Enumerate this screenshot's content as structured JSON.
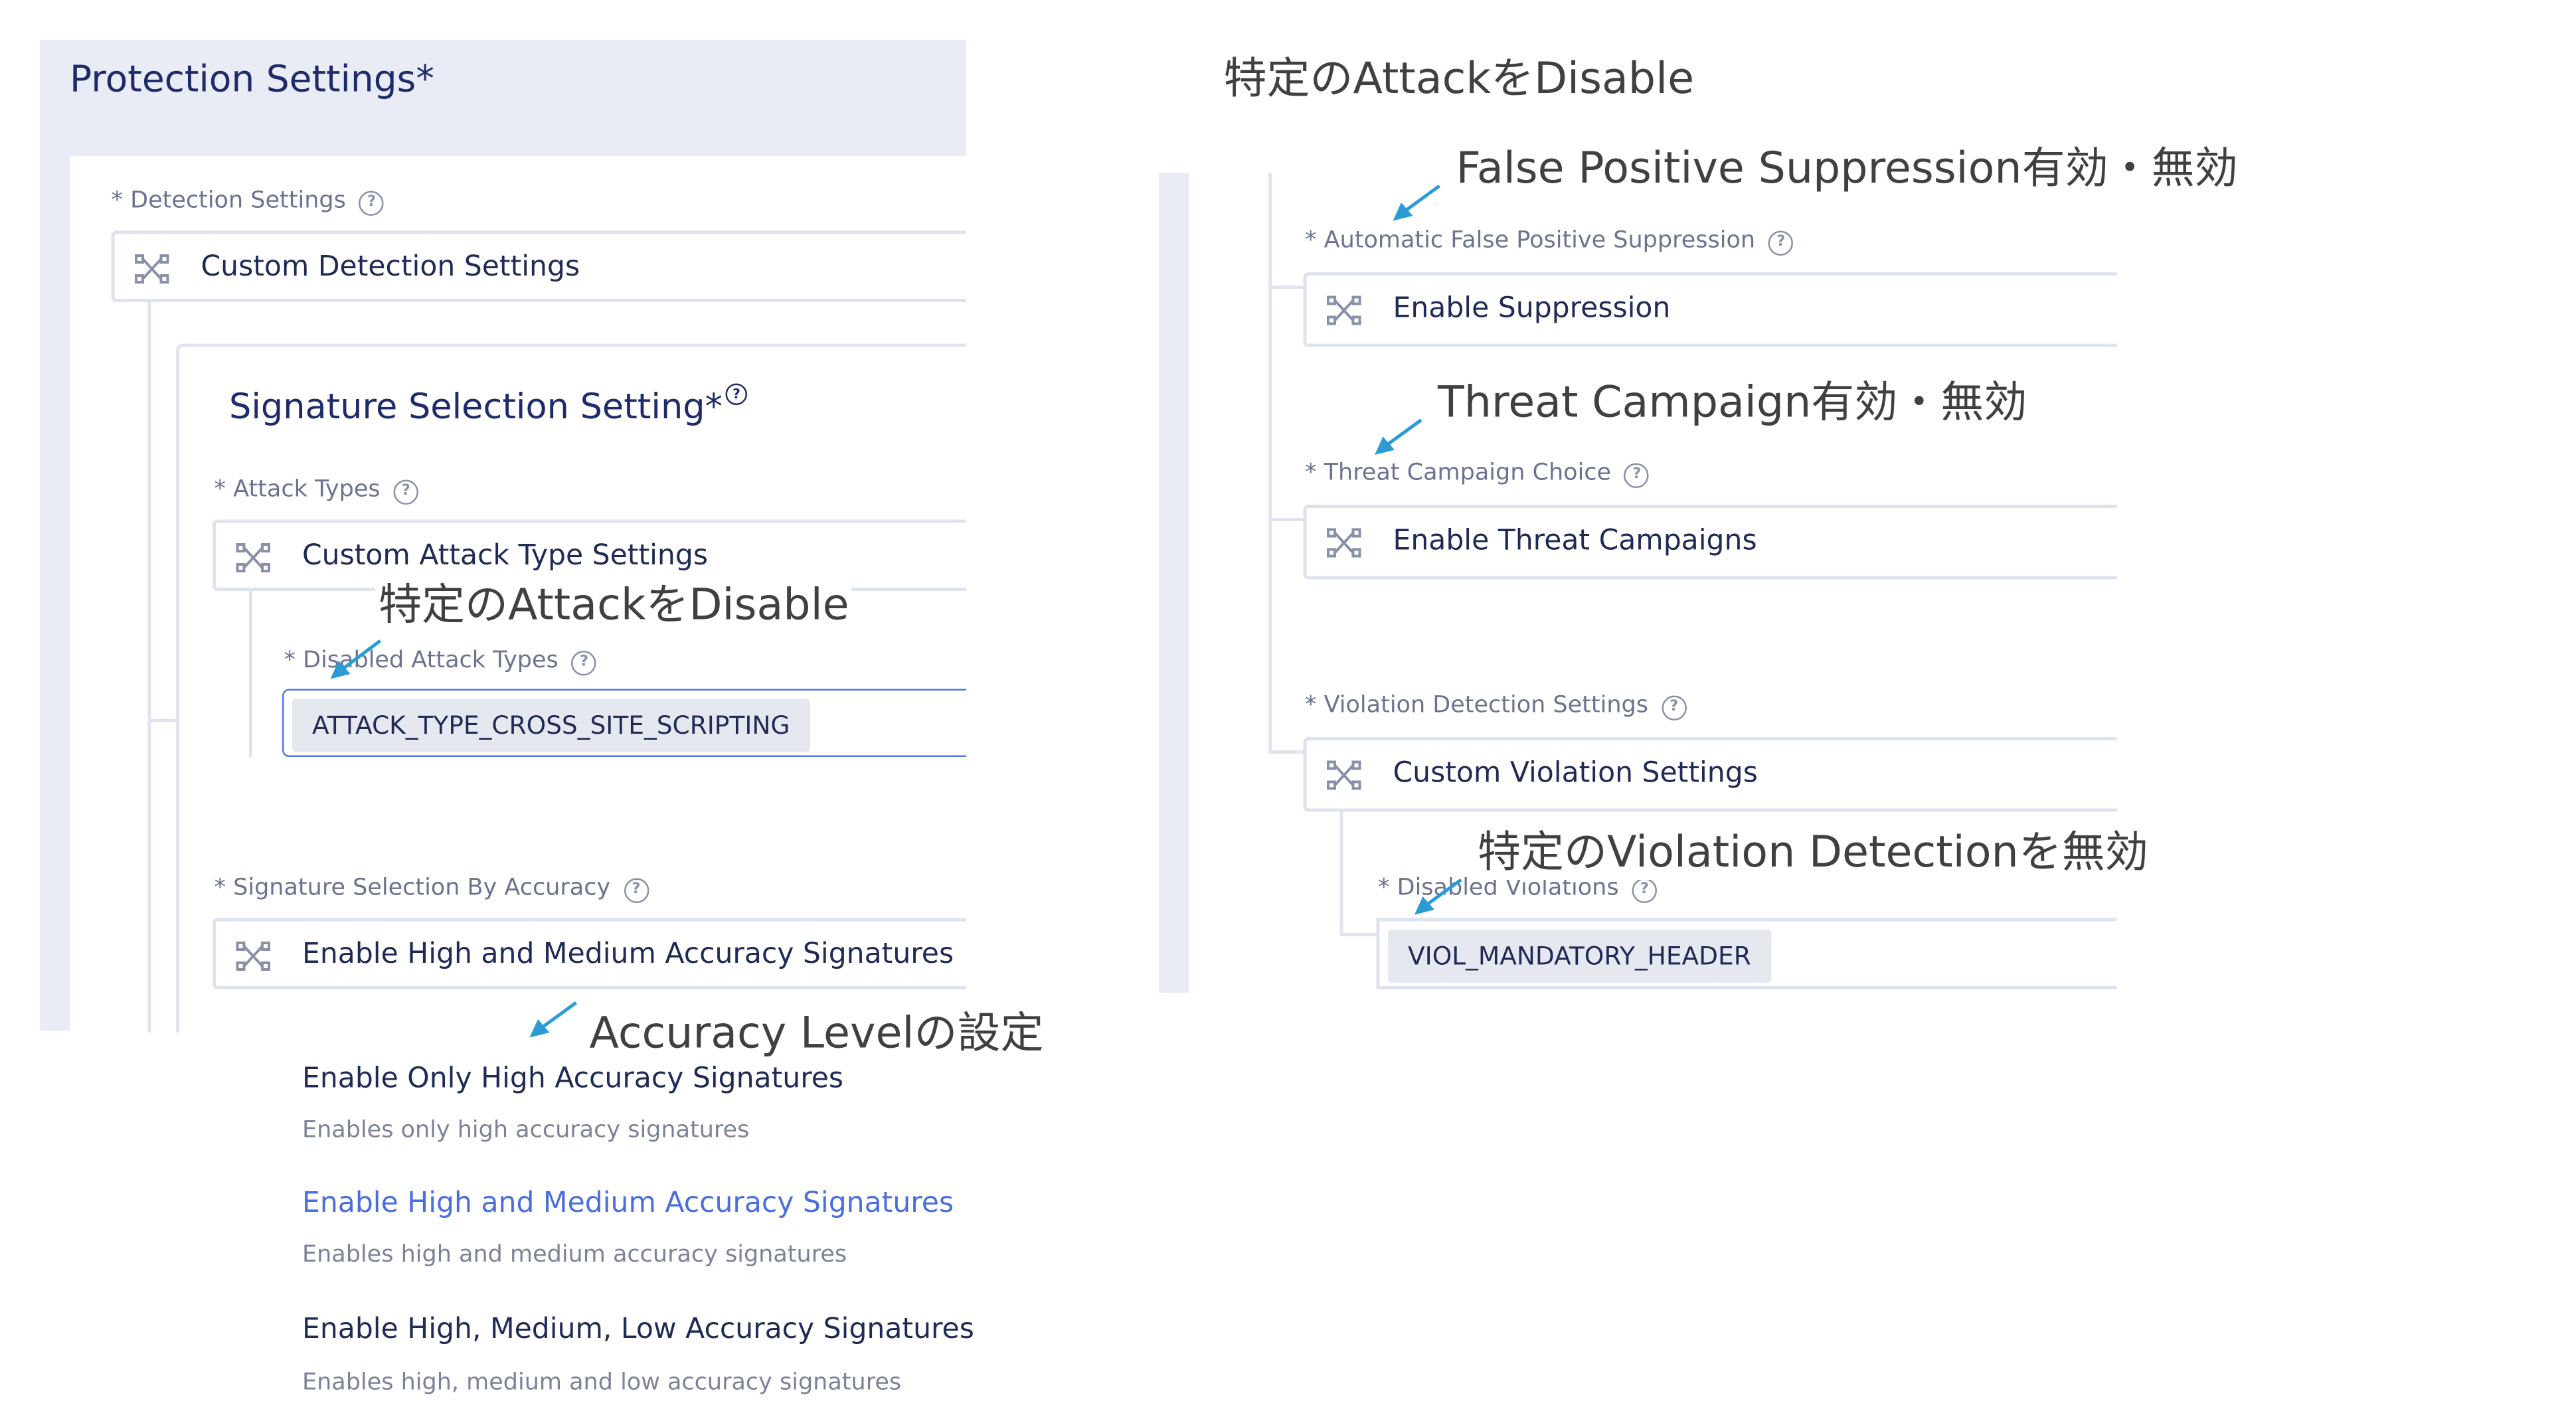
{
  "left_panel": {
    "title": "Protection Settings",
    "required_mark": "*",
    "detection_settings": {
      "label": "* Detection Settings",
      "value": "Custom Detection Settings"
    },
    "signature_section": {
      "title": "Signature Selection Setting",
      "required_mark": "*",
      "attack_types": {
        "label": "* Attack Types",
        "value": "Custom Attack Type Settings"
      },
      "disabled_attack_types": {
        "label": "* Disabled Attack Types",
        "chip": "ATTACK_TYPE_CROSS_SITE_SCRIPTING"
      },
      "accuracy": {
        "label": "* Signature Selection By Accuracy",
        "value": "Enable High and Medium Accuracy Signatures"
      }
    },
    "dropdown_options": [
      {
        "title": "Enable Only High Accuracy Signatures",
        "desc": "Enables only high accuracy signatures",
        "selected": false
      },
      {
        "title": "Enable High and Medium Accuracy Signatures",
        "desc": "Enables high and medium accuracy signatures",
        "selected": true
      },
      {
        "title": "Enable High, Medium, Low Accuracy Signatures",
        "desc": "Enables high, medium and low accuracy signatures",
        "selected": false
      }
    ]
  },
  "right_panel": {
    "false_positive": {
      "label": "* Automatic False Positive Suppression",
      "value": "Enable Suppression"
    },
    "threat_campaign": {
      "label": "* Threat Campaign Choice",
      "value": "Enable Threat Campaigns"
    },
    "violation_detection": {
      "label": "* Violation Detection Settings",
      "value": "Custom Violation Settings"
    },
    "disabled_violations": {
      "label": "* Disabled Violations",
      "chip": "VIOL_MANDATORY_HEADER"
    }
  },
  "annotations": {
    "top_heading": "特定のAttackをDisable",
    "disable_attack": "特定のAttackをDisable",
    "accuracy_level": "Accuracy Levelの設定",
    "false_positive": "False Positive Suppression有効・無効",
    "threat_campaign": "Threat Campaign有効・無効",
    "violation": "特定のViolation Detectionを無効"
  },
  "icons": {
    "help": "question-circle-icon",
    "select": "shuffle-icon",
    "arrow": "arrow-down-left-icon"
  },
  "colors": {
    "panel_bg": "#e9ecf5",
    "text_primary": "#1f2a55",
    "accent": "#4a6ee0",
    "annotation_arrow": "#2b9bd6",
    "chip_bg": "#e6e8f0"
  }
}
